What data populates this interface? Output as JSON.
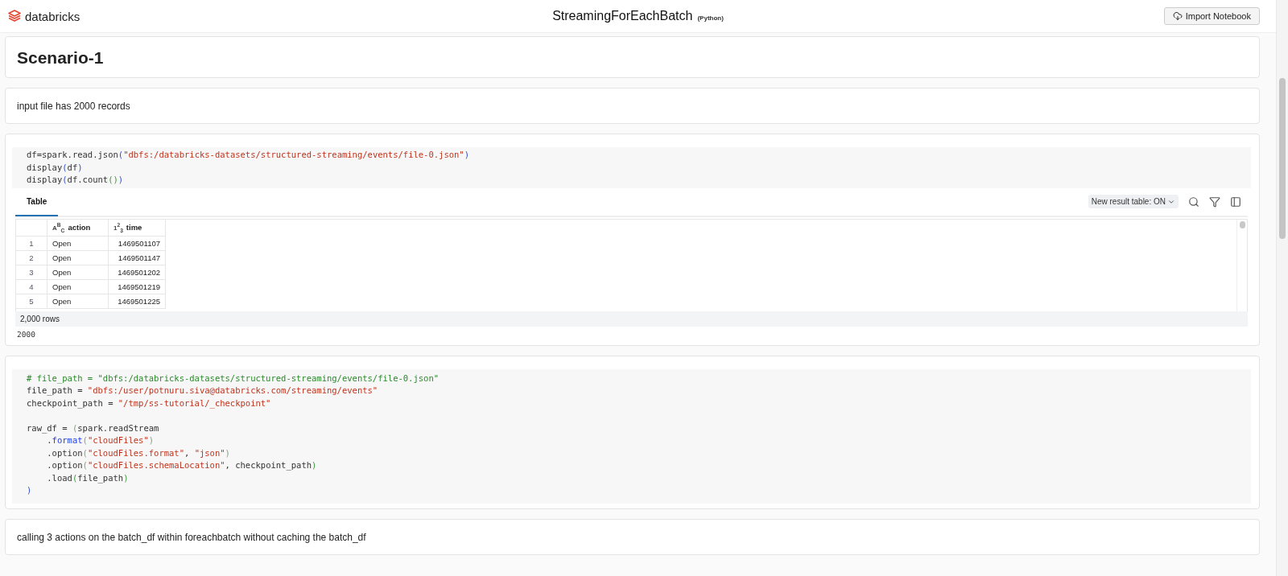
{
  "header": {
    "logo": "databricks",
    "title": "StreamingForEachBatch",
    "language": "(Python)",
    "import_button": "Import Notebook"
  },
  "cells": [
    {
      "kind": "heading",
      "text": "Scenario-1"
    },
    {
      "kind": "markdown",
      "text": "input file has 2000 records"
    },
    {
      "kind": "code",
      "lines": [
        {
          "kind": "code",
          "tokens": [
            {
              "kind": "plain",
              "t": "df=spark.read.json"
            },
            {
              "kind": "bracket",
              "t": "("
            },
            {
              "kind": "string",
              "t": "\"dbfs:/databricks-datasets/structured-streaming/events/file-0.json\""
            },
            {
              "kind": "bracket",
              "t": ")"
            }
          ]
        },
        {
          "kind": "code",
          "tokens": [
            {
              "kind": "plain",
              "t": "display"
            },
            {
              "kind": "bracket",
              "t": "("
            },
            {
              "kind": "plain",
              "t": "df"
            },
            {
              "kind": "bracket",
              "t": ")"
            }
          ]
        },
        {
          "kind": "code",
          "tokens": [
            {
              "kind": "plain",
              "t": "display"
            },
            {
              "kind": "bracket",
              "t": "("
            },
            {
              "kind": "plain",
              "t": "df.count"
            },
            {
              "kind": "inner",
              "t": "()"
            },
            {
              "kind": "bracket",
              "t": ")"
            }
          ]
        }
      ],
      "output": {
        "tabs": [
          {
            "label": "Table",
            "selected": true
          }
        ],
        "toggle": "New result table: ON",
        "columns": [
          {
            "type": "A$^{B}$$_{C}$",
            "name": "action"
          },
          {
            "type": "1$^{2}$$_{3}$",
            "name": "time"
          }
        ],
        "rows": [
          {
            "index": "1",
            "cells": [
              "Open",
              "1469501107"
            ]
          },
          {
            "index": "2",
            "cells": [
              "Open",
              "1469501147"
            ]
          },
          {
            "index": "3",
            "cells": [
              "Open",
              "1469501202"
            ]
          },
          {
            "index": "4",
            "cells": [
              "Open",
              "1469501219"
            ]
          },
          {
            "index": "5",
            "cells": [
              "Open",
              "1469501225"
            ]
          }
        ],
        "row_count": "2,000 rows",
        "result": "2000"
      }
    },
    {
      "kind": "code",
      "lines": [
        {
          "kind": "code",
          "tokens": [
            {
              "kind": "comment",
              "t": "# file_path = \"dbfs:/databricks-datasets/structured-streaming/events/file-0.json\""
            }
          ]
        },
        {
          "kind": "code",
          "tokens": [
            {
              "kind": "plain",
              "t": "file_path = "
            },
            {
              "kind": "string",
              "t": "\"dbfs:/user/potnuru.siva@databricks.com/streaming/events\""
            }
          ]
        },
        {
          "kind": "code",
          "tokens": [
            {
              "kind": "plain",
              "t": "checkpoint_path = "
            },
            {
              "kind": "string",
              "t": "\"/tmp/ss-tutorial/_checkpoint\""
            }
          ]
        },
        {
          "kind": "blank"
        },
        {
          "kind": "code",
          "tokens": [
            {
              "kind": "plain",
              "t": "raw_df = "
            },
            {
              "kind": "faint",
              "t": "("
            },
            {
              "kind": "plain",
              "t": "spark.readStream"
            }
          ]
        },
        {
          "kind": "code",
          "tokens": [
            {
              "kind": "plain",
              "t": "    ."
            },
            {
              "kind": "method",
              "t": "format"
            },
            {
              "kind": "faint",
              "t": "("
            },
            {
              "kind": "string",
              "t": "\"cloudFiles\""
            },
            {
              "kind": "faint",
              "t": ")"
            }
          ]
        },
        {
          "kind": "code",
          "tokens": [
            {
              "kind": "plain",
              "t": "    .option"
            },
            {
              "kind": "faint",
              "t": "("
            },
            {
              "kind": "string",
              "t": "\"cloudFiles.format\""
            },
            {
              "kind": "plain",
              "t": ", "
            },
            {
              "kind": "string",
              "t": "\"json\""
            },
            {
              "kind": "faint",
              "t": ")"
            }
          ]
        },
        {
          "kind": "code",
          "tokens": [
            {
              "kind": "plain",
              "t": "    .option"
            },
            {
              "kind": "faint",
              "t": "("
            },
            {
              "kind": "string",
              "t": "\"cloudFiles.schemaLocation\""
            },
            {
              "kind": "plain",
              "t": ", checkpoint_path"
            },
            {
              "kind": "inner",
              "t": ")"
            }
          ]
        },
        {
          "kind": "code",
          "tokens": [
            {
              "kind": "plain",
              "t": "    .load"
            },
            {
              "kind": "inner",
              "t": "("
            },
            {
              "kind": "plain",
              "t": "file_path"
            },
            {
              "kind": "inner",
              "t": ")"
            }
          ]
        },
        {
          "kind": "code",
          "tokens": [
            {
              "kind": "bracket",
              "t": ")"
            }
          ]
        }
      ]
    },
    {
      "kind": "markdown",
      "text": "calling 3 actions on the batch_df within foreachbatch without caching the batch_df"
    }
  ]
}
